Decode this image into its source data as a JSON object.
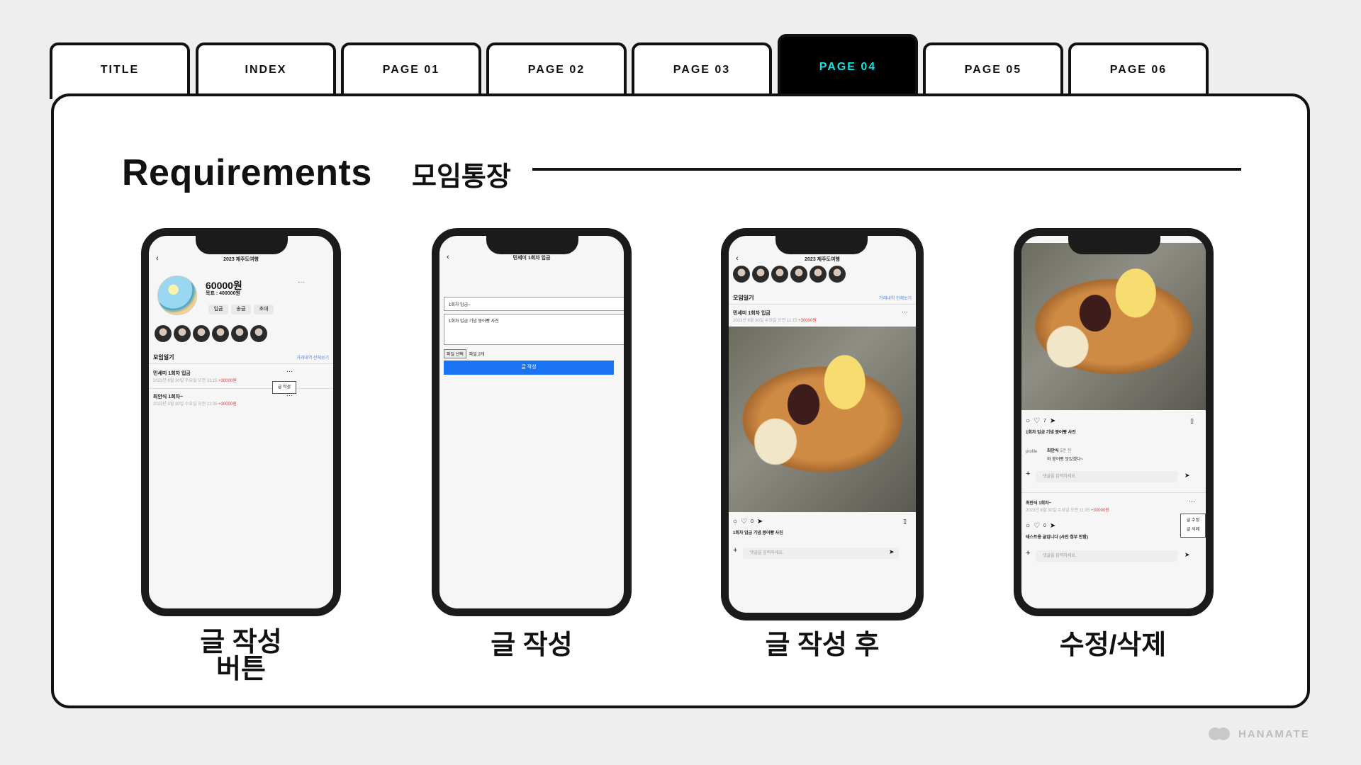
{
  "tabs": [
    {
      "label": "TITLE",
      "active": false
    },
    {
      "label": "INDEX",
      "active": false
    },
    {
      "label": "PAGE 01",
      "active": false
    },
    {
      "label": "PAGE 02",
      "active": false
    },
    {
      "label": "PAGE 03",
      "active": false
    },
    {
      "label": "PAGE 04",
      "active": true
    },
    {
      "label": "PAGE 05",
      "active": false
    },
    {
      "label": "PAGE 06",
      "active": false
    }
  ],
  "header": {
    "title": "Requirements",
    "subtitle": "모임통장"
  },
  "phones": [
    {
      "caption_line1": "글 작성",
      "caption_line2": "버튼",
      "screen": {
        "title": "2023 제주도여행",
        "amount": "60000원",
        "goal": "목표 : 400000원",
        "chips": [
          "입금",
          "송금",
          "초대"
        ],
        "section": "모임일기",
        "view_all": "거래내역 전체보기",
        "posts": [
          {
            "title": "민세미 1회차 입금",
            "meta": "2023년 8월 30일 수요일 오전 11:15",
            "amount": "+30000원"
          },
          {
            "title": "최안식 1회차~",
            "meta": "2023년 8월 30일 수요일 오전 11:05",
            "amount": "+30000원"
          }
        ],
        "popup": "글 작성"
      }
    },
    {
      "caption_line1": "글 작성",
      "screen": {
        "title": "민세미 1회차 입금",
        "title_field": "1회차 입금~",
        "body_field": "1회차 입금 기념 붕어빵 사진",
        "file_btn": "파일 선택",
        "file_count": "파일 2개",
        "submit": "글 작성"
      }
    },
    {
      "caption_line1": "글 작성 후",
      "screen": {
        "title": "2023 제주도여행",
        "section": "모임일기",
        "view_all": "거래내역 전체보기",
        "post_title": "민세미 1회차 입금",
        "post_meta": "2023년 8월 30일 수요일 오전 11:15",
        "post_amount": "+30000원",
        "likes": "0",
        "caption": "1회차 입금 기념 붕어빵 사진",
        "comment_placeholder": "댓글을 입력하세요."
      }
    },
    {
      "caption_line1": "수정/삭제",
      "screen": {
        "likes1": "7",
        "caption1": "1회차 입금 기념 붕어빵 사진",
        "commenter": "최안식",
        "comment_time": "5분 전",
        "comment_text": "와 붕어빵 맛있겠다~",
        "profile_alt": "profile",
        "comment_placeholder": "댓글을 입력하세요.",
        "post2_title": "최안식 1회차~",
        "post2_meta": "2023년 8월 30일 수요일 오전 11:05",
        "post2_amount": "+30000원",
        "likes2": "0",
        "caption2": "테스트용 글입니다 (사진 첨부 안함)",
        "edit": "글 수정",
        "delete": "글 삭제"
      }
    }
  ],
  "logo": {
    "text": "HANAMATE"
  }
}
